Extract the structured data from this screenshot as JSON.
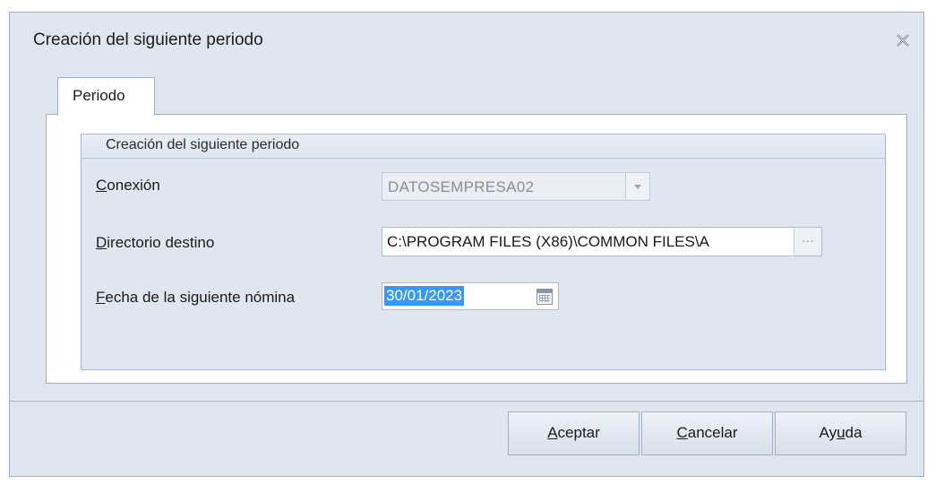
{
  "window": {
    "title": "Creación del siguiente periodo"
  },
  "tabs": [
    {
      "label": "Periodo",
      "selected": true
    }
  ],
  "group": {
    "title": "Creación del siguiente periodo"
  },
  "fields": {
    "conexion": {
      "label_key": "C",
      "label_rest": "onexión",
      "value": "DATOSEMPRESA02",
      "disabled": true
    },
    "directorio": {
      "label_key": "D",
      "label_rest": "irectorio destino",
      "value": "C:\\PROGRAM FILES (X86)\\COMMON FILES\\A",
      "ellipsis": "···"
    },
    "fecha": {
      "label_key": "F",
      "label_rest": "echa de la siguiente nómina",
      "value": "30/01/2023"
    }
  },
  "buttons": {
    "aceptar": {
      "key": "A",
      "rest": "ceptar"
    },
    "cancelar": {
      "key": "C",
      "rest": "ancelar"
    },
    "ayuda": {
      "pre": "Ay",
      "key": "u",
      "rest": "da"
    }
  },
  "colors": {
    "window_bg": "#dfe6f0",
    "border": "#9fb0c8",
    "selection": "#3399ff"
  },
  "icons": {
    "close": "close-icon",
    "combo_dropdown": "chevron-down-icon",
    "calendar": "calendar-icon",
    "browse": "ellipsis-icon"
  }
}
